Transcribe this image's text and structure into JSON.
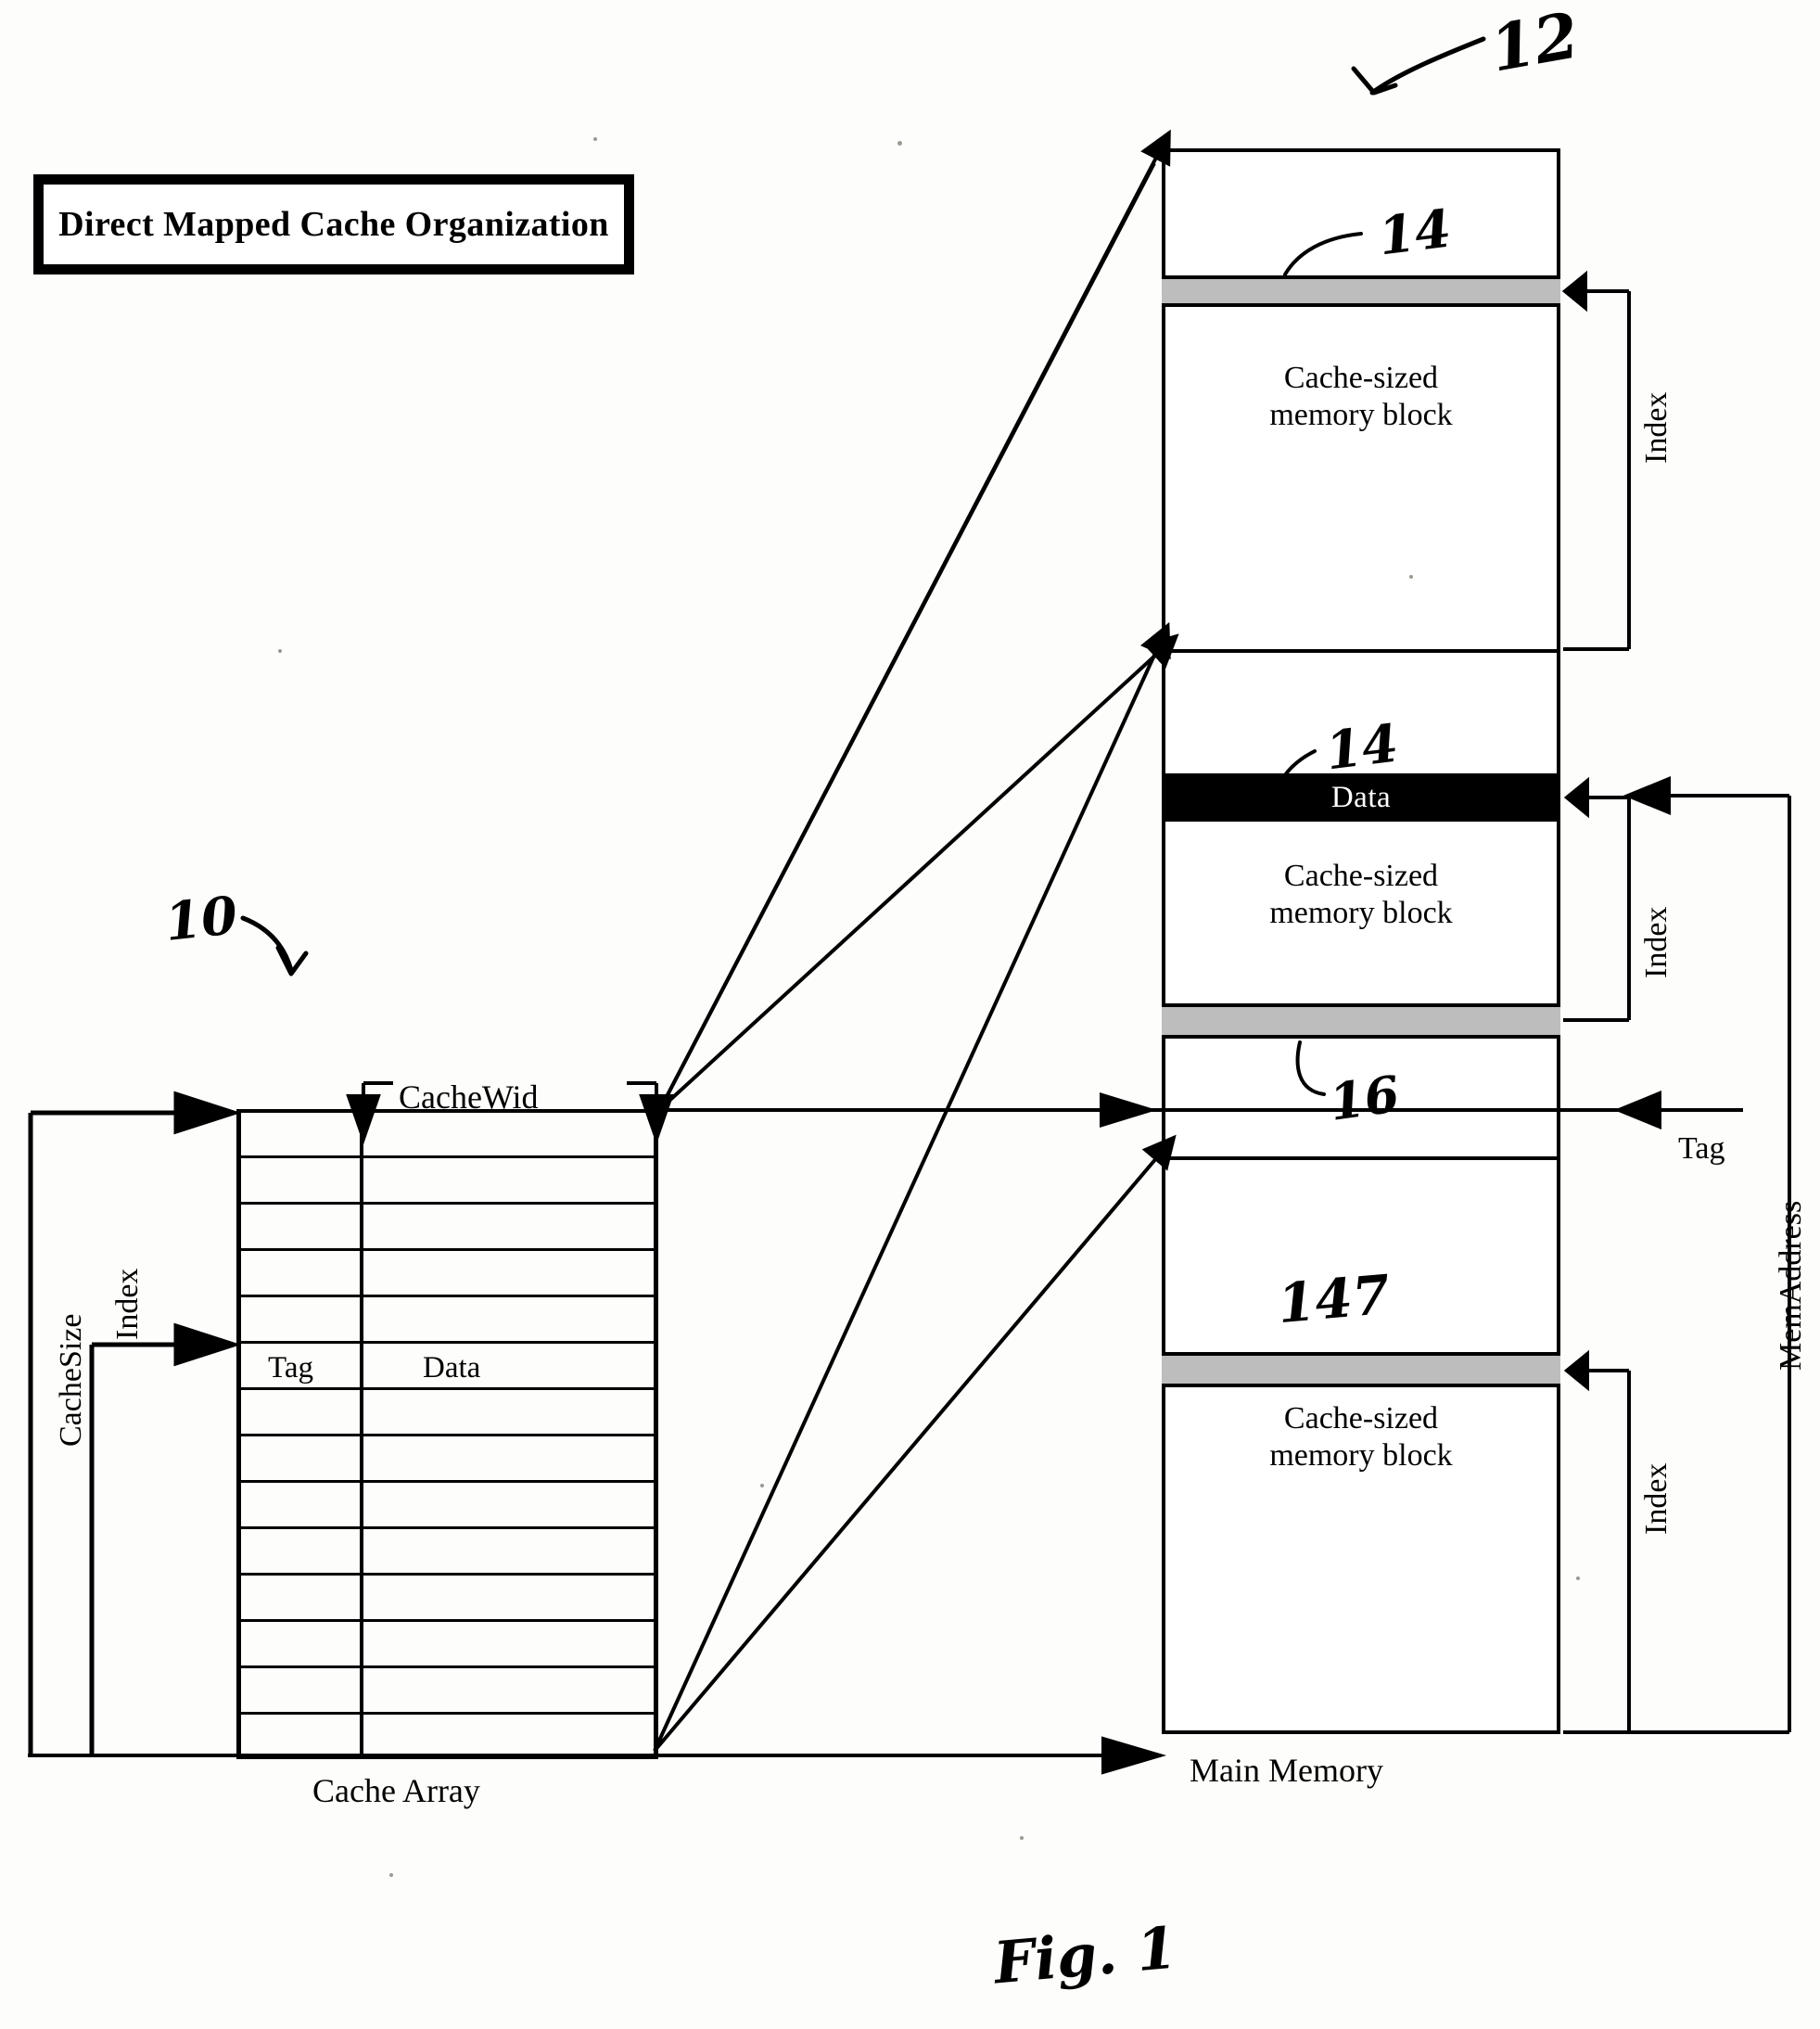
{
  "figure": {
    "title": "Direct Mapped Cache Organization",
    "caption": "Fig. 1"
  },
  "reference_numerals": [
    {
      "id": "ref-12",
      "text": "12",
      "target": "main-memory"
    },
    {
      "id": "ref-10",
      "text": "10",
      "target": "cache-array"
    },
    {
      "id": "ref-14-top",
      "text": "14",
      "target": "top-gray-band"
    },
    {
      "id": "ref-14-mid",
      "text": "14",
      "target": "data-band"
    },
    {
      "id": "ref-16",
      "text": "16",
      "target": "middle-gray-band"
    },
    {
      "id": "ref-147",
      "text": "147",
      "target": "lower-gray-band"
    }
  ],
  "cache": {
    "label": "Cache Array",
    "width_label": "CacheWid",
    "size_label": "CacheSize",
    "index_label": "Index",
    "columns": [
      "Tag",
      "Data"
    ],
    "row_count": 14
  },
  "memory": {
    "label": "Main Memory",
    "blocks": [
      {
        "line1": "Cache-sized",
        "line2": "memory block"
      },
      {
        "line1": "Cache-sized",
        "line2": "memory block"
      },
      {
        "line1": "Cache-sized",
        "line2": "memory block"
      }
    ],
    "data_band_label": "Data",
    "index_labels": [
      "Index",
      "Index",
      "Index"
    ],
    "tag_label": "Tag",
    "address_label": "MemAddress"
  },
  "colors": {
    "ink": "#000000",
    "gray_band": "#bdbdbd",
    "paper": "#fdfdfb"
  }
}
